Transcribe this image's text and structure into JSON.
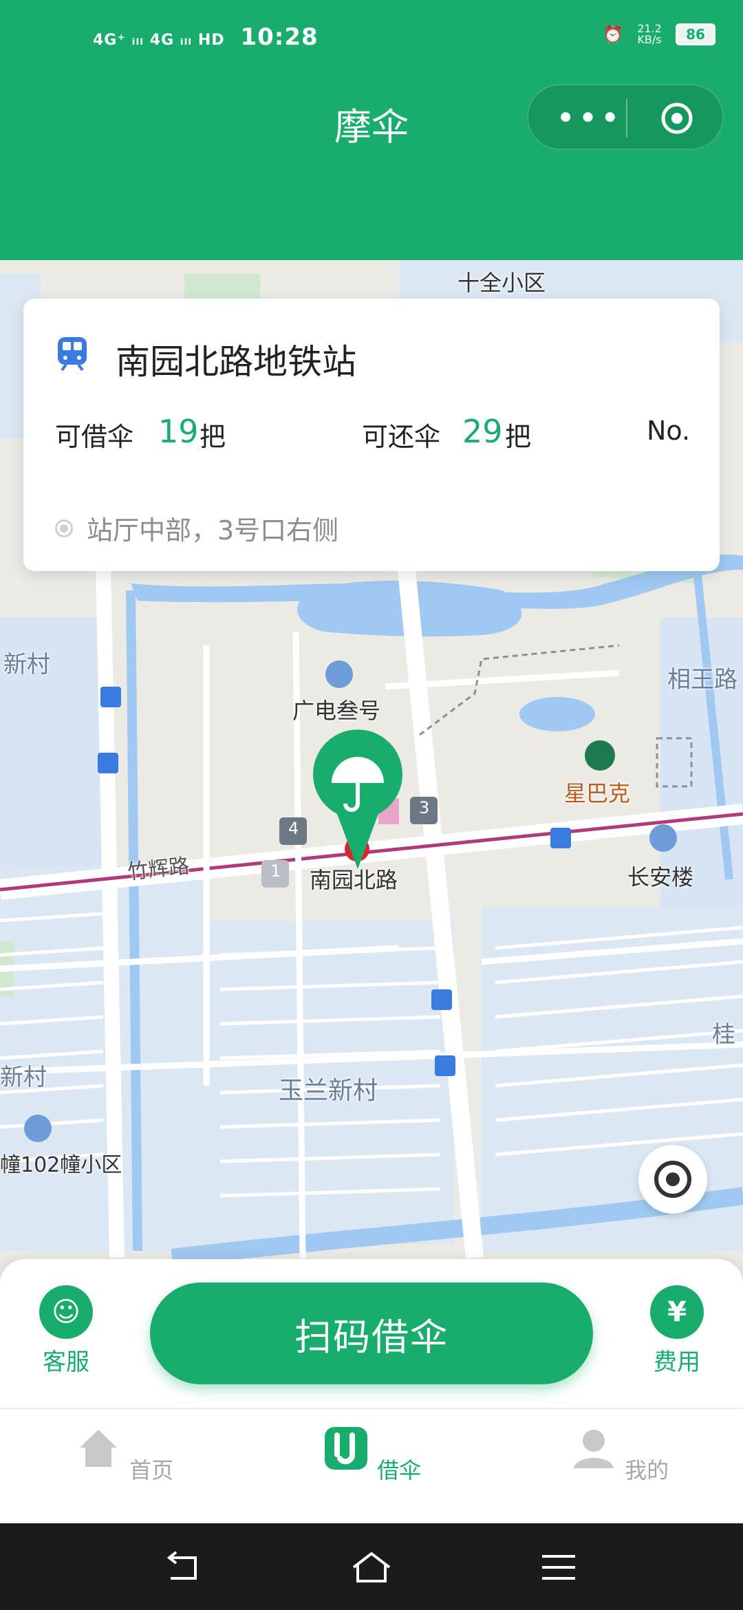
{
  "status_bar": {
    "network": "4G⁺ ᵢₗₗ 4G ᵢₗₗ HD",
    "time": "10:28",
    "speed": "21.2 KB/s",
    "battery": "86"
  },
  "header": {
    "title": "摩伞"
  },
  "station_card": {
    "station_name": "南园北路地铁站",
    "borrow_label": "可借伞",
    "borrow_count": "19",
    "return_label": "可还伞",
    "return_count": "29",
    "unit": "把",
    "no_label": "No.",
    "location_text": "站厅中部，3号口右侧"
  },
  "map": {
    "labels": [
      "十全小区",
      "广电叁号",
      "星巴克",
      "长安楼",
      "南园北路",
      "竹辉路",
      "玉兰新村",
      "新村",
      "相王路",
      "桂",
      "新村",
      "幢102幢小区"
    ],
    "exit_numbers": [
      "4",
      "3",
      "1"
    ]
  },
  "actions": {
    "service_label": "客服",
    "scan_label": "扫码借伞",
    "fee_label": "费用"
  },
  "tabs": [
    {
      "label": "首页",
      "icon": "home-icon"
    },
    {
      "label": "借伞",
      "icon": "umbrella-tab-icon"
    },
    {
      "label": "我的",
      "icon": "profile-icon"
    }
  ],
  "colors": {
    "brand_green": "#18ad6c",
    "metro_line": "#b03a7a"
  }
}
